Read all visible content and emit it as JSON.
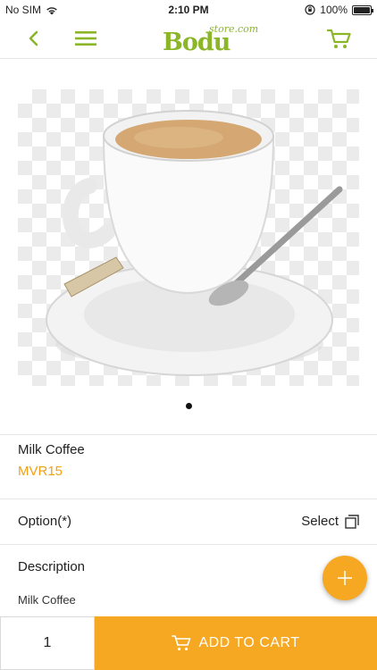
{
  "status_bar": {
    "carrier": "No SIM",
    "time": "2:10 PM",
    "battery": "100%"
  },
  "header": {
    "logo_main": "Bodu",
    "logo_sub": "store.com"
  },
  "product": {
    "name": "Milk Coffee",
    "price": "MVR15"
  },
  "option": {
    "label": "Option(*)",
    "value": "Select"
  },
  "description": {
    "label": "Description",
    "text": "Milk Coffee"
  },
  "cart_bar": {
    "quantity": "1",
    "add_label": "ADD TO CART"
  },
  "colors": {
    "accent": "#f7a823",
    "brand_green": "#8bb628"
  },
  "carousel": {
    "total": 1,
    "active": 1
  }
}
